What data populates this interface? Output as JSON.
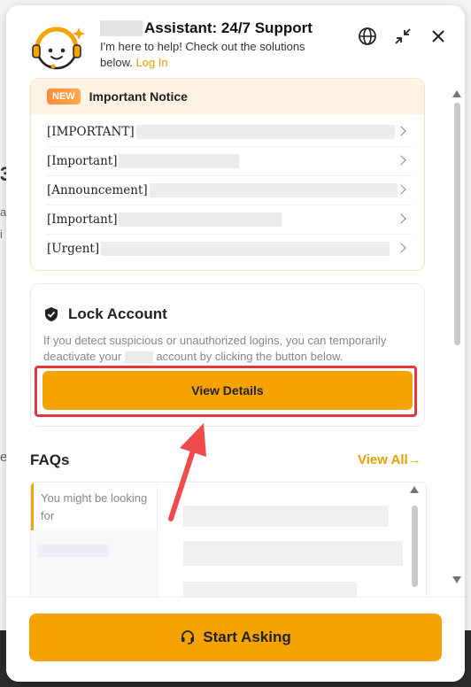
{
  "header": {
    "title": "Assistant: 24/7 Support",
    "subtitle": "I'm here to help! Check out the solutions below.",
    "login_link": "Log In"
  },
  "notice": {
    "badge": "NEW",
    "title": "Important Notice",
    "items": [
      {
        "label": "[IMPORTANT]"
      },
      {
        "label": "[Important]"
      },
      {
        "label": "[Announcement]"
      },
      {
        "label": "[Important]"
      },
      {
        "label": "[Urgent]"
      }
    ]
  },
  "lock_account": {
    "title": "Lock Account",
    "description_part1": "If you detect suspicious or unauthorized logins, you can temporarily deactivate your",
    "description_part2": "account by clicking the button below.",
    "button_label": "View Details"
  },
  "faqs": {
    "title": "FAQs",
    "view_all": "View All",
    "category": "You might be looking for"
  },
  "footer": {
    "button_label": "Start Asking"
  },
  "colors": {
    "accent": "#f5a300",
    "link": "#e8a000",
    "highlight_border": "#e2393b",
    "annotation_arrow": "#ef4b4b"
  },
  "icons": {
    "avatar": "assistant-avatar-icon",
    "language": "globe-icon",
    "minimize": "collapse-icon",
    "close": "close-icon",
    "lock": "shield-icon",
    "headset": "headset-icon"
  }
}
